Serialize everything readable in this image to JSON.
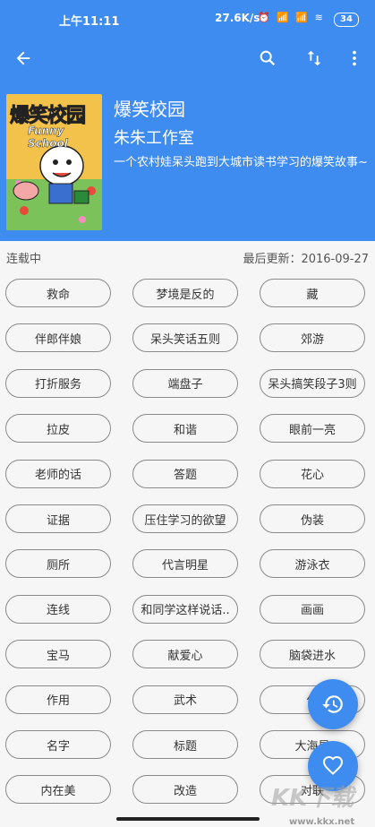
{
  "status": {
    "time": "上午11:11",
    "net_speed": "27.6K/s",
    "indicators": "⏰ 📶 📶 ≋",
    "battery": "34"
  },
  "toolbar": {
    "back_icon": "arrow-left-icon",
    "search_icon": "search-icon",
    "sort_icon": "sort-icon",
    "more_icon": "more-vert-icon"
  },
  "book": {
    "title": "爆笑校园",
    "author": "朱朱工作室",
    "description": "一个农村娃呆头跑到大城市读书学习的爆笑故事~",
    "cover_text": "爆笑校园",
    "cover_subtext": "Funny School"
  },
  "meta": {
    "status": "连载中",
    "updated": "最后更新：2016-09-27"
  },
  "chapters": [
    "救命",
    "梦境是反的",
    "藏",
    "伴郎伴娘",
    "呆头笑话五则",
    "郊游",
    "打折服务",
    "端盘子",
    "呆头搞笑段子3则",
    "拉皮",
    "和谐",
    "眼前一亮",
    "老师的话",
    "答题",
    "花心",
    "证据",
    "压住学习的欲望",
    "伪装",
    "厕所",
    "代言明星",
    "游泳衣",
    "连线",
    "和同学这样说话..",
    "画画",
    "宝马",
    "献爱心",
    "脑袋进水",
    "作用",
    "武术",
    "作",
    "名字",
    "标题",
    "大海是",
    "内在美",
    "改造",
    "对联"
  ],
  "fabs": {
    "history_icon": "history-icon",
    "favorite_icon": "heart-icon"
  },
  "watermark": {
    "text": "KK下载",
    "url": "www.kkx.net"
  },
  "colors": {
    "primary": "#3f8cf0",
    "background": "#f6f6f6"
  }
}
